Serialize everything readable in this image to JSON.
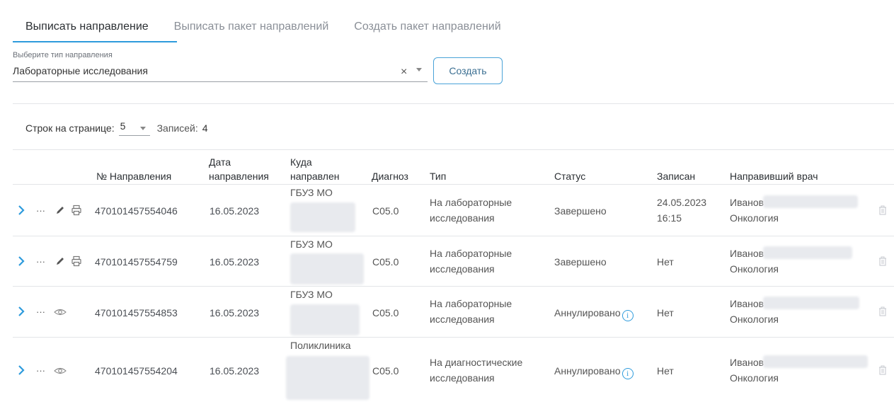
{
  "tabs": [
    {
      "label": "Выписать направление",
      "active": true
    },
    {
      "label": "Выписать пакет направлений",
      "active": false
    },
    {
      "label": "Создать пакет направлений",
      "active": false
    }
  ],
  "direction_type": {
    "caption": "Выберите тип направления",
    "value": "Лабораторные исследования",
    "clear_glyph": "×"
  },
  "create_button": "Создать",
  "pager": {
    "rows_label": "Строк на странице:",
    "rows_value": "5",
    "records_label": "Записей:",
    "records_value": "4"
  },
  "table": {
    "headers": {
      "number": "№ Направления",
      "date_line1": "Дата",
      "date_line2": "направления",
      "dest_line1": "Куда",
      "dest_line2": "направлен",
      "diagnosis": "Диагноз",
      "type": "Тип",
      "status": "Статус",
      "booked": "Записан",
      "doctor": "Направивший врач"
    },
    "rows": [
      {
        "number": "470101457554046",
        "date": "16.05.2023",
        "dest": "ГБУЗ МО",
        "diagnosis": "C05.0",
        "type_line1": "На лабораторные",
        "type_line2": "исследования",
        "status": "Завершено",
        "booked_line1": "24.05.2023",
        "booked_line2": "16:15",
        "doctor_name": "Иванов",
        "doctor_dept": "Онкология"
      },
      {
        "number": "470101457554759",
        "date": "16.05.2023",
        "dest": "ГБУЗ МО",
        "diagnosis": "C05.0",
        "type_line1": "На лабораторные",
        "type_line2": "исследования",
        "status": "Завершено",
        "booked_line1": "Нет",
        "booked_line2": "",
        "doctor_name": "Иванов",
        "doctor_dept": "Онкология"
      },
      {
        "number": "470101457554853",
        "date": "16.05.2023",
        "dest": "ГБУЗ МО",
        "diagnosis": "C05.0",
        "type_line1": "На лабораторные",
        "type_line2": "исследования",
        "status": "Аннулировано",
        "booked_line1": "Нет",
        "booked_line2": "",
        "doctor_name": "Иванов",
        "doctor_dept": "Онкология"
      },
      {
        "number": "470101457554204",
        "date": "16.05.2023",
        "dest": "Поликлиника",
        "diagnosis": "C05.0",
        "type_line1": "На диагностические",
        "type_line2": "исследования",
        "status": "Аннулировано",
        "booked_line1": "Нет",
        "booked_line2": "",
        "doctor_name": "Иванов",
        "doctor_dept": "Онкология"
      }
    ],
    "info_glyph": "i"
  },
  "colors": {
    "accent": "#2e9bdc",
    "chevron": "#2e9bdc",
    "text": "#333333",
    "muted": "#8a8f97",
    "divider": "#e3e5e8"
  }
}
